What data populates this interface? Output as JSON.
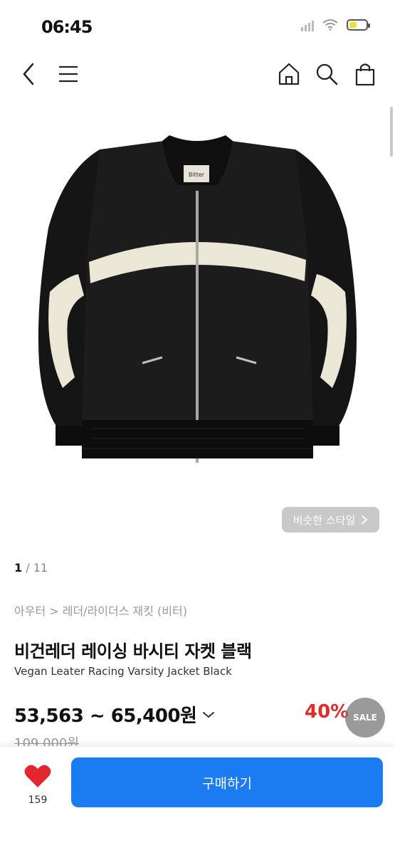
{
  "status": {
    "time": "06:45"
  },
  "nav": {
    "back_icon": "chevron-left-icon",
    "menu_icon": "hamburger-menu-icon",
    "home_icon": "home-icon",
    "search_icon": "search-icon",
    "cart_icon": "shopping-bag-icon"
  },
  "gallery": {
    "current": "1",
    "separator": "/",
    "total": "11",
    "similar_label": "비슷한 스타일"
  },
  "product": {
    "breadcrumb": "아우터 > 레더/라이더스 재킷 (비터)",
    "name_ko": "비건레더 레이싱 바시티 자켓 블랙",
    "name_en": "Vegan Leater Racing Varsity Jacket Black",
    "price_range": "53,563 ~ 65,400원",
    "discount": "40%",
    "sale_badge": "SALE",
    "original_price": "109,000원",
    "brand_label": "Bitter"
  },
  "bottom": {
    "like_count": "159",
    "buy_label": "구매하기"
  },
  "colors": {
    "accent": "#1a7cf0",
    "discount": "#e12a2a",
    "heart": "#e1262d"
  }
}
